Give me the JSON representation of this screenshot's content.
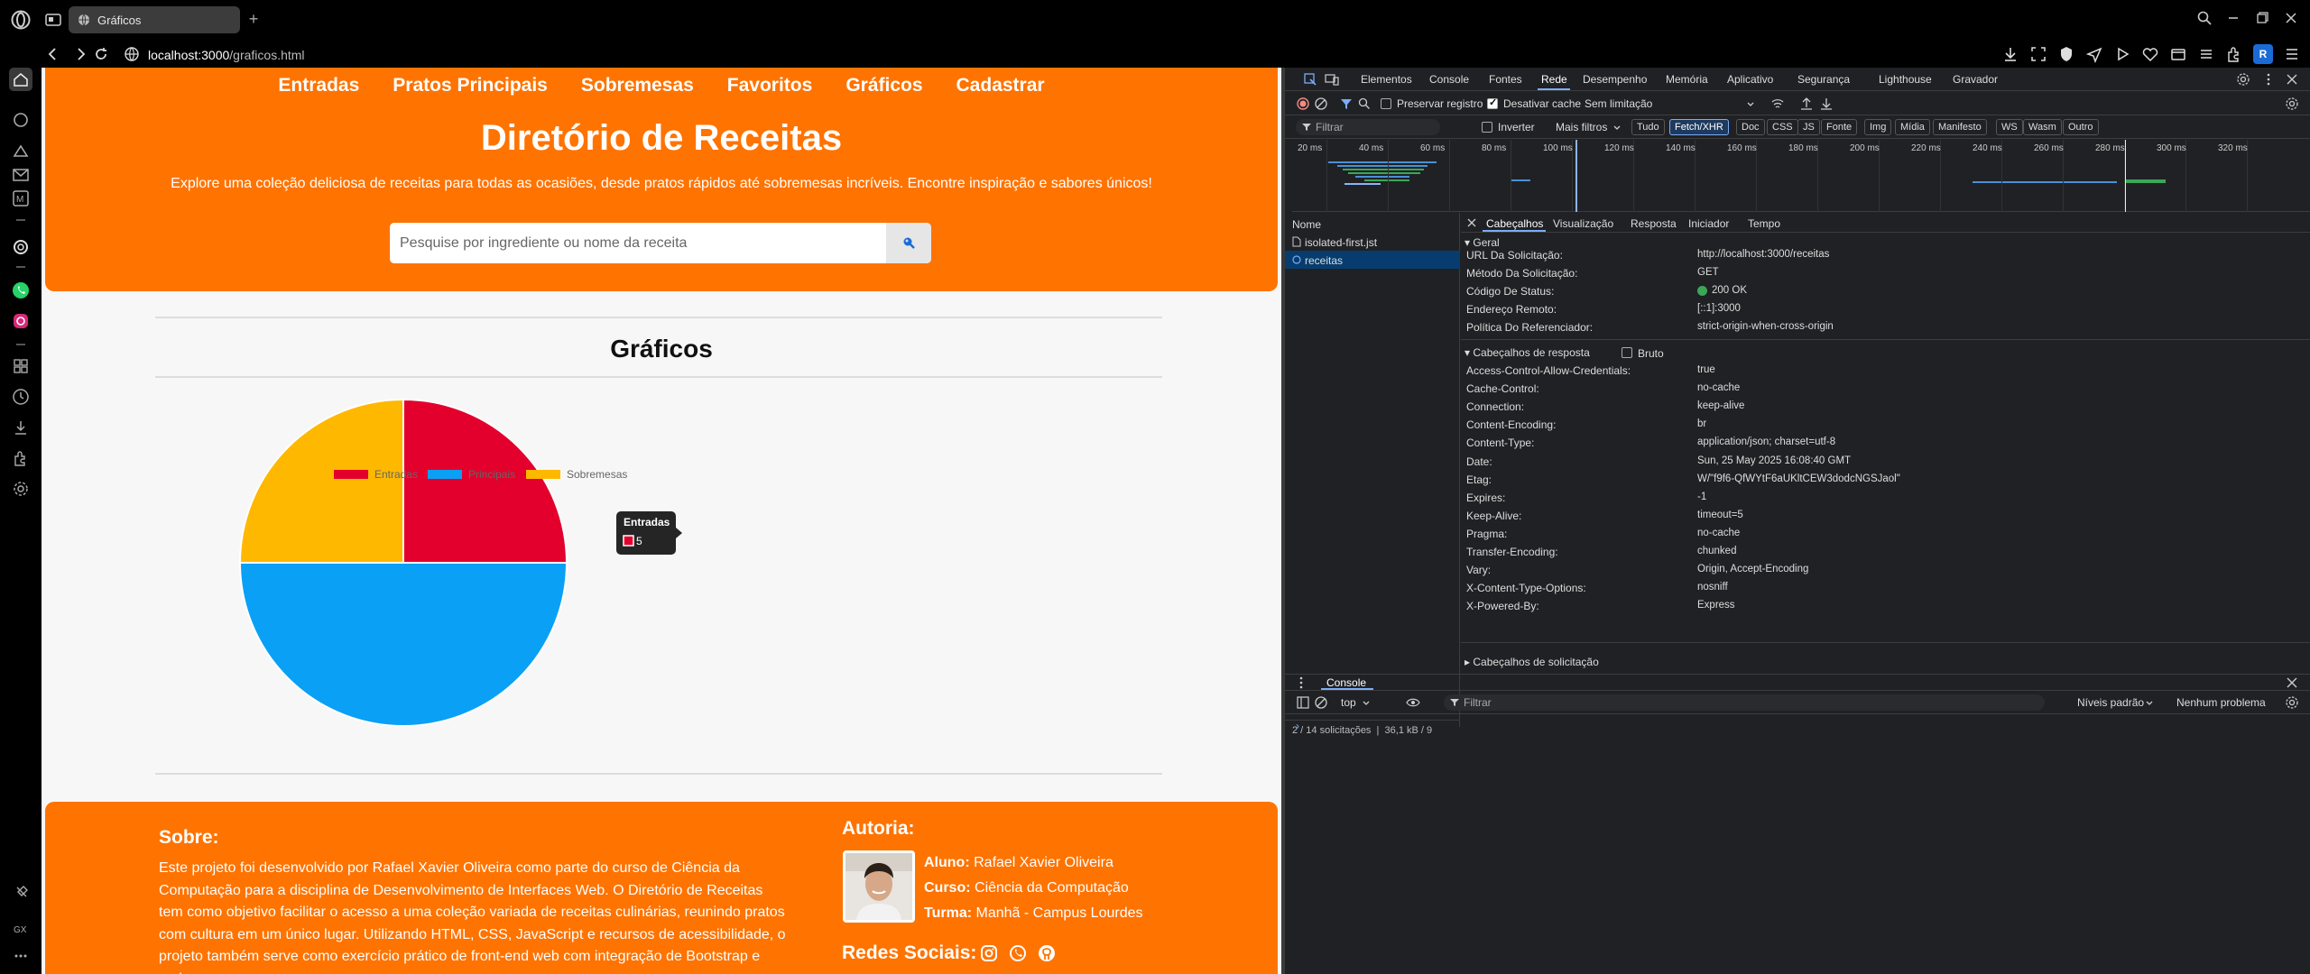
{
  "browser": {
    "tab_title": "Gráficos",
    "url_host": "localhost:3000",
    "url_path": "/graficos.html",
    "profile_letter": "R"
  },
  "site": {
    "nav": [
      "Entradas",
      "Pratos Principais",
      "Sobremesas",
      "Favoritos",
      "Gráficos",
      "Cadastrar"
    ],
    "title": "Diretório de Receitas",
    "subtitle": "Explore uma coleção deliciosa de receitas para todas as ocasiões, desde pratos rápidos até sobremesas incríveis. Encontre inspiração e sabores únicos!",
    "search_placeholder": "Pesquise por ingrediente ou nome da receita",
    "section_title": "Gráficos",
    "footer": {
      "about_title": "Sobre:",
      "about_text": "Este projeto foi desenvolvido por Rafael Xavier Oliveira como parte do curso de Ciência da Computação para a disciplina de Desenvolvimento de Interfaces Web. O Diretório de Receitas tem como objetivo facilitar o acesso a uma coleção variada de receitas culinárias, reunindo pratos com cultura em um único lugar. Utilizando HTML, CSS, JavaScript e recursos de acessibilidade, o projeto também serve como exercício prático de front-end web com integração de Bootstrap e mais.",
      "author_title": "Autoria:",
      "student_label": "Aluno:",
      "student_value": "Rafael Xavier Oliveira",
      "course_label": "Curso:",
      "course_value": "Ciência da Computação",
      "class_label": "Turma:",
      "class_value": "Manhã - Campus Lourdes",
      "social_title": "Redes Sociais:"
    }
  },
  "chart_data": {
    "type": "pie",
    "categories": [
      "Entradas",
      "Principais",
      "Sobremesas"
    ],
    "values": [
      5,
      10,
      5
    ],
    "colors": [
      "#e3002d",
      "#0aa0f5",
      "#ffb800"
    ],
    "tooltip": {
      "title": "Entradas",
      "value": "5"
    },
    "legend_position": "top"
  },
  "devtools": {
    "tabs": [
      "Elementos",
      "Console",
      "Fontes",
      "Rede",
      "Desempenho",
      "Memória",
      "Aplicativo",
      "Segurança",
      "Lighthouse",
      "Gravador"
    ],
    "active_tab": "Rede",
    "preserve_log": "Preservar registro",
    "disable_cache": "Desativar cache",
    "throttle": "Sem limitação",
    "filter_placeholder": "Filtrar",
    "invert": "Inverter",
    "more_filters": "Mais filtros",
    "type_filters": [
      "Tudo",
      "Fetch/XHR",
      "Doc",
      "CSS",
      "JS",
      "Fonte",
      "Img",
      "Mídia",
      "Manifesto",
      "WS",
      "Wasm",
      "Outro"
    ],
    "active_type_filter": "Fetch/XHR",
    "timeline_ticks": [
      "20 ms",
      "40 ms",
      "60 ms",
      "80 ms",
      "100 ms",
      "120 ms",
      "140 ms",
      "160 ms",
      "180 ms",
      "200 ms",
      "220 ms",
      "240 ms",
      "260 ms",
      "280 ms",
      "300 ms",
      "320 ms"
    ],
    "list_header": "Nome",
    "requests": [
      "isolated-first.jst",
      "receitas"
    ],
    "status_bar": "2 / 14 solicitações",
    "status_bar_size": "36,1 kB / 9",
    "detail_tabs": [
      "Cabeçalhos",
      "Visualização",
      "Resposta",
      "Iniciador",
      "Tempo"
    ],
    "general_title": "Geral",
    "general": [
      {
        "k": "URL Da Solicitação:",
        "v": "http://localhost:3000/receitas"
      },
      {
        "k": "Método Da Solicitação:",
        "v": "GET"
      },
      {
        "k": "Código De Status:",
        "v": "200 OK"
      },
      {
        "k": "Endereço Remoto:",
        "v": "[::1]:3000"
      },
      {
        "k": "Política Do Referenciador:",
        "v": "strict-origin-when-cross-origin"
      }
    ],
    "response_headers_title": "Cabeçalhos de resposta",
    "raw_label": "Bruto",
    "response_headers": [
      {
        "k": "Access-Control-Allow-Credentials:",
        "v": "true"
      },
      {
        "k": "Cache-Control:",
        "v": "no-cache"
      },
      {
        "k": "Connection:",
        "v": "keep-alive"
      },
      {
        "k": "Content-Encoding:",
        "v": "br"
      },
      {
        "k": "Content-Type:",
        "v": "application/json; charset=utf-8"
      },
      {
        "k": "Date:",
        "v": "Sun, 25 May 2025 16:08:40 GMT"
      },
      {
        "k": "Etag:",
        "v": "W/\"f9f6-QfWYtF6aUKltCEW3dodcNGSJaol\""
      },
      {
        "k": "Expires:",
        "v": "-1"
      },
      {
        "k": "Keep-Alive:",
        "v": "timeout=5"
      },
      {
        "k": "Pragma:",
        "v": "no-cache"
      },
      {
        "k": "Transfer-Encoding:",
        "v": "chunked"
      },
      {
        "k": "Vary:",
        "v": "Origin, Accept-Encoding"
      },
      {
        "k": "X-Content-Type-Options:",
        "v": "nosniff"
      },
      {
        "k": "X-Powered-By:",
        "v": "Express"
      }
    ],
    "request_headers_title": "Cabeçalhos de solicitação",
    "console_tab": "Console",
    "console_context": "top",
    "console_filter": "Filtrar",
    "console_levels": "Níveis padrão",
    "console_issues": "Nenhum problema"
  }
}
